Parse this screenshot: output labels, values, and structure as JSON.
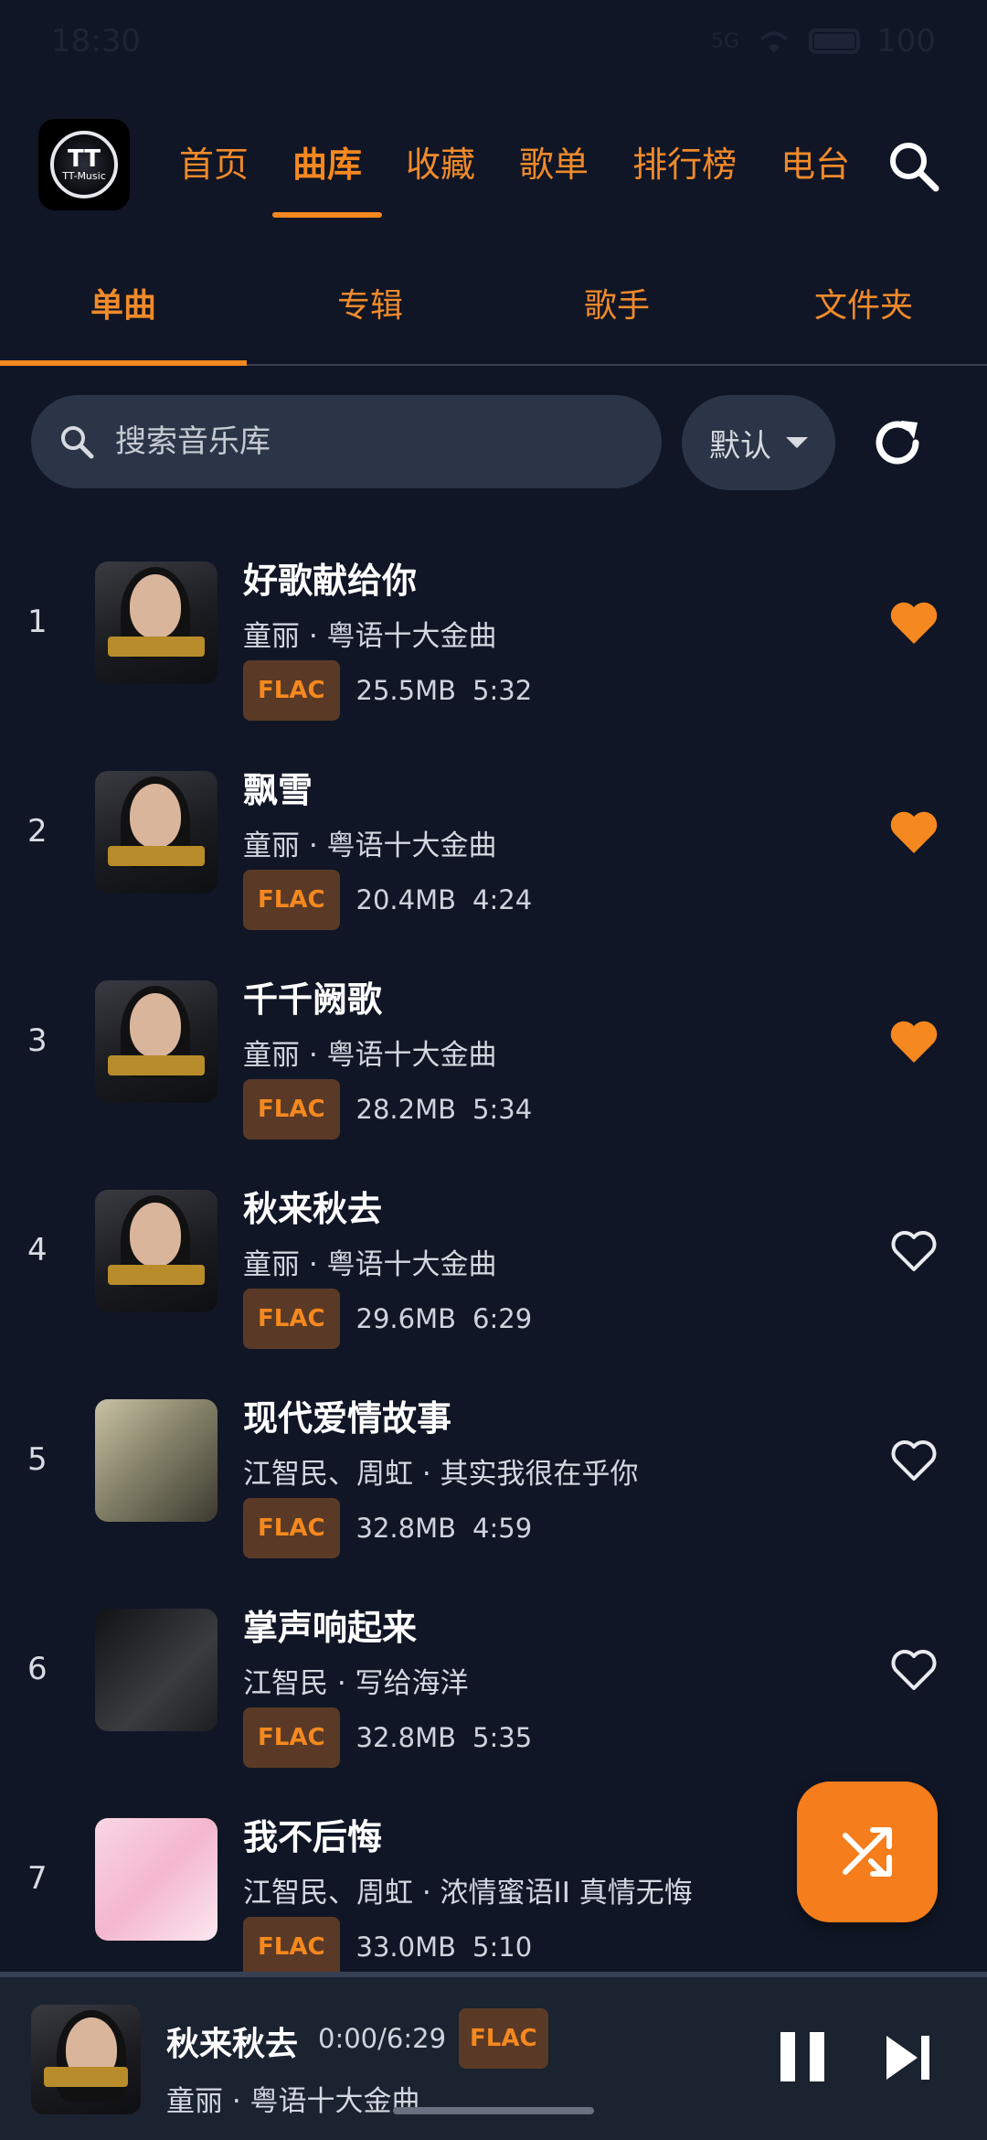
{
  "status_bar": {
    "time": "18:30",
    "signal": "5G",
    "battery": "100"
  },
  "header": {
    "app_logo_text": "TT-Music",
    "nav": [
      {
        "label": "首页",
        "active": false
      },
      {
        "label": "曲库",
        "active": true
      },
      {
        "label": "收藏",
        "active": false
      },
      {
        "label": "歌单",
        "active": false
      },
      {
        "label": "排行榜",
        "active": false
      },
      {
        "label": "电台",
        "active": false
      }
    ]
  },
  "subtabs": [
    {
      "label": "单曲",
      "active": true
    },
    {
      "label": "专辑",
      "active": false
    },
    {
      "label": "歌手",
      "active": false
    },
    {
      "label": "文件夹",
      "active": false
    }
  ],
  "search": {
    "placeholder": "搜索音乐库",
    "value": ""
  },
  "sort": {
    "selected": "默认"
  },
  "songs": [
    {
      "index": "1",
      "title": "好歌献给你",
      "artist_album": "童丽 · 粤语十大金曲",
      "format": "FLAC",
      "size": "25.5MB",
      "duration": "5:32",
      "liked": true
    },
    {
      "index": "2",
      "title": "飘雪",
      "artist_album": "童丽 · 粤语十大金曲",
      "format": "FLAC",
      "size": "20.4MB",
      "duration": "4:24",
      "liked": true
    },
    {
      "index": "3",
      "title": "千千阙歌",
      "artist_album": "童丽 · 粤语十大金曲",
      "format": "FLAC",
      "size": "28.2MB",
      "duration": "5:34",
      "liked": true
    },
    {
      "index": "4",
      "title": "秋来秋去",
      "artist_album": "童丽 · 粤语十大金曲",
      "format": "FLAC",
      "size": "29.6MB",
      "duration": "6:29",
      "liked": false
    },
    {
      "index": "5",
      "title": "现代爱情故事",
      "artist_album": "江智民、周虹 · 其实我很在乎你",
      "format": "FLAC",
      "size": "32.8MB",
      "duration": "4:59",
      "liked": false
    },
    {
      "index": "6",
      "title": "掌声响起来",
      "artist_album": "江智民 · 写给海洋",
      "format": "FLAC",
      "size": "32.8MB",
      "duration": "5:35",
      "liked": false
    },
    {
      "index": "7",
      "title": "我不后悔",
      "artist_album": "江智民、周虹 · 浓情蜜语II 真情无悔",
      "format": "FLAC",
      "size": "33.0MB",
      "duration": "5:10",
      "liked": null
    }
  ],
  "now_playing": {
    "title": "秋来秋去",
    "time": "0:00/6:29",
    "format": "FLAC",
    "artist_album": "童丽 · 粤语十大金曲",
    "progress": 0
  },
  "colors": {
    "background": "#101626",
    "accent": "#f5881f",
    "badge_bg": "#5a3a26",
    "surface": "#2b3547"
  }
}
